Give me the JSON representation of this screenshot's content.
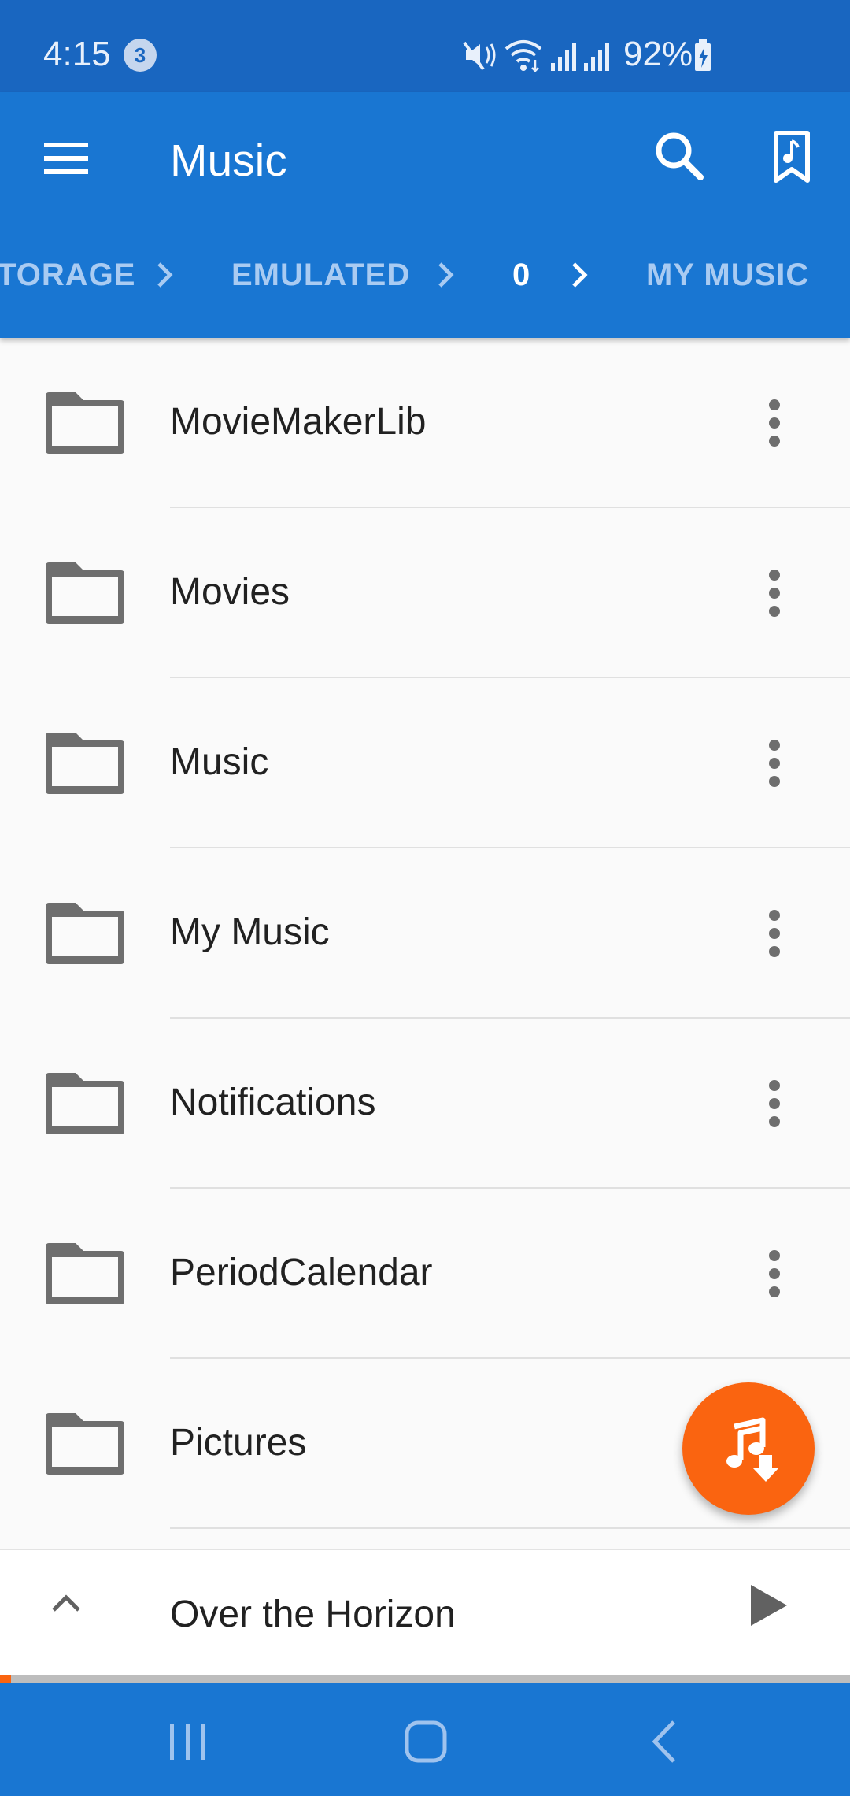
{
  "status_bar": {
    "time": "4:15",
    "notification_count": "3",
    "battery": "92%",
    "icons": [
      "mute-vibrate-icon",
      "wifi-icon",
      "signal-icon",
      "signal-icon",
      "battery-charging-icon"
    ]
  },
  "app_bar": {
    "title": "Music",
    "icons": [
      "menu-icon",
      "search-icon",
      "music-bookmark-icon"
    ],
    "breadcrumb": [
      "TORAGE",
      "EMULATED",
      "0",
      "MY MUSIC"
    ]
  },
  "folders": [
    {
      "name": "MovieMakerLib"
    },
    {
      "name": "Movies"
    },
    {
      "name": "Music"
    },
    {
      "name": "My Music"
    },
    {
      "name": "Notifications"
    },
    {
      "name": "PeriodCalendar"
    },
    {
      "name": "Pictures"
    }
  ],
  "now_playing": {
    "title": "Over the Horizon",
    "progress": 0.013
  },
  "colors": {
    "primary": "#1976d2",
    "status_bar": "#1966c0",
    "accent": "#fa6410",
    "folder_icon": "#6e6e6e"
  }
}
